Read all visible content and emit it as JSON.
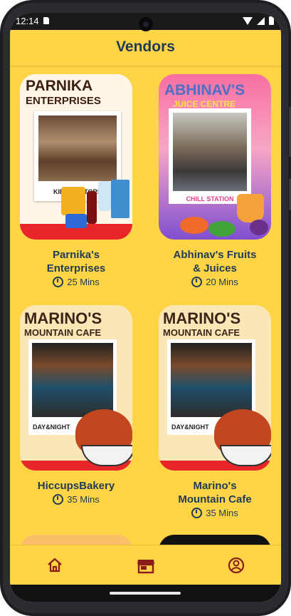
{
  "status_bar": {
    "time": "12:14"
  },
  "header": {
    "title": "Vendors"
  },
  "vendors": [
    {
      "name_line1": "Parnika's",
      "name_line2": "Enterprises",
      "time": "25 Mins",
      "banner_line1": "PARNIKA",
      "banner_line2": "ENTERPRISES",
      "caption": "KIRANA STORE"
    },
    {
      "name_line1": "Abhinav's Fruits",
      "name_line2": "& Juices",
      "time": "20 Mins",
      "banner_line1": "ABHINAV'S",
      "banner_line2": "JUICE CENTRE",
      "caption": "CHILL STATION"
    },
    {
      "name_line1": "HiccupsBakery",
      "name_line2": "",
      "time": "35 Mins",
      "banner_line1": "MARINO'S",
      "banner_line2": "MOUNTAIN CAFE",
      "caption": "DAY&NIGHT"
    },
    {
      "name_line1": "Marino's",
      "name_line2": "Mountain Cafe",
      "time": "35 Mins",
      "banner_line1": "MARINO'S",
      "banner_line2": "MOUNTAIN CAFE",
      "caption": "DAY&NIGHT"
    }
  ],
  "bottom_nav": {
    "items": [
      "home-icon",
      "store-icon",
      "profile-icon"
    ],
    "active": "store-icon"
  },
  "colors": {
    "background": "#ffd447",
    "title": "#1f3b55",
    "accent": "#8b1c1c"
  }
}
